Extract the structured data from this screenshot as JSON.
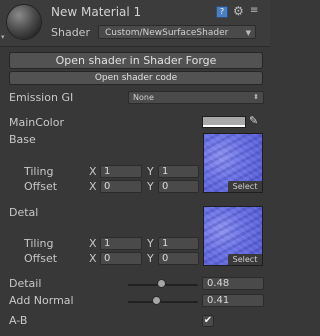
{
  "header": {
    "material_name": "New Material 1",
    "shader_label": "Shader",
    "shader_value": "Custom/NewSurfaceShader",
    "icons": [
      "material-sphere-icon",
      "book-icon",
      "gear-icon",
      "context-menu-icon",
      "foldout-icon"
    ]
  },
  "buttons": {
    "open_shader_forge": "Open shader in Shader Forge",
    "open_shader_code": "Open shader code"
  },
  "emission": {
    "label": "Emission GI",
    "value": "None"
  },
  "main_color": {
    "label": "MainColor",
    "color": "#a9a9a9"
  },
  "base": {
    "label": "Base",
    "tiling_label": "Tiling",
    "offset_label": "Offset",
    "x_label": "X",
    "y_label": "Y",
    "tiling_x": "1",
    "tiling_y": "1",
    "offset_x": "0",
    "offset_y": "0",
    "select_label": "Select"
  },
  "detal": {
    "label": "Detal",
    "tiling_label": "Tiling",
    "offset_label": "Offset",
    "x_label": "X",
    "y_label": "Y",
    "tiling_x": "1",
    "tiling_y": "1",
    "offset_x": "0",
    "offset_y": "0",
    "select_label": "Select"
  },
  "sliders": [
    {
      "label": "Detail",
      "value": "0.48",
      "fraction": 0.48
    },
    {
      "label": "Add Normal",
      "value": "0.41",
      "fraction": 0.41
    }
  ],
  "ab": {
    "label": "A-B",
    "checked": true,
    "check_glyph": "✔"
  }
}
